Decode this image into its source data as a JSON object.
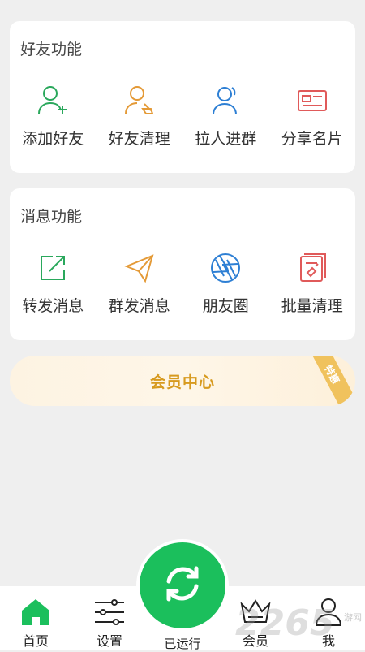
{
  "friends_card": {
    "title": "好友功能",
    "items": [
      {
        "label": "添加好友",
        "icon": "add-friend-icon",
        "color": "#2aa85c"
      },
      {
        "label": "好友清理",
        "icon": "friend-clean-icon",
        "color": "#e49a37"
      },
      {
        "label": "拉人进群",
        "icon": "invite-group-icon",
        "color": "#2d7fd4"
      },
      {
        "label": "分享名片",
        "icon": "share-card-icon",
        "color": "#e05a5a"
      }
    ]
  },
  "message_card": {
    "title": "消息功能",
    "items": [
      {
        "label": "转发消息",
        "icon": "forward-icon",
        "color": "#2aa85c"
      },
      {
        "label": "群发消息",
        "icon": "send-plane-icon",
        "color": "#e49a37"
      },
      {
        "label": "朋友圈",
        "icon": "moments-icon",
        "color": "#2d7fd4"
      },
      {
        "label": "批量清理",
        "icon": "batch-clean-icon",
        "color": "#e05a5a"
      }
    ]
  },
  "member_center": {
    "label": "会员中心",
    "ribbon": "特惠"
  },
  "tabbar": {
    "home": "首页",
    "settings": "设置",
    "running": "已运行",
    "member": "会员",
    "me": "我"
  },
  "watermark": {
    "big": "2265",
    "small": "游网"
  },
  "colors": {
    "accent_green": "#1bbf5c",
    "gold": "#d79a1e"
  }
}
